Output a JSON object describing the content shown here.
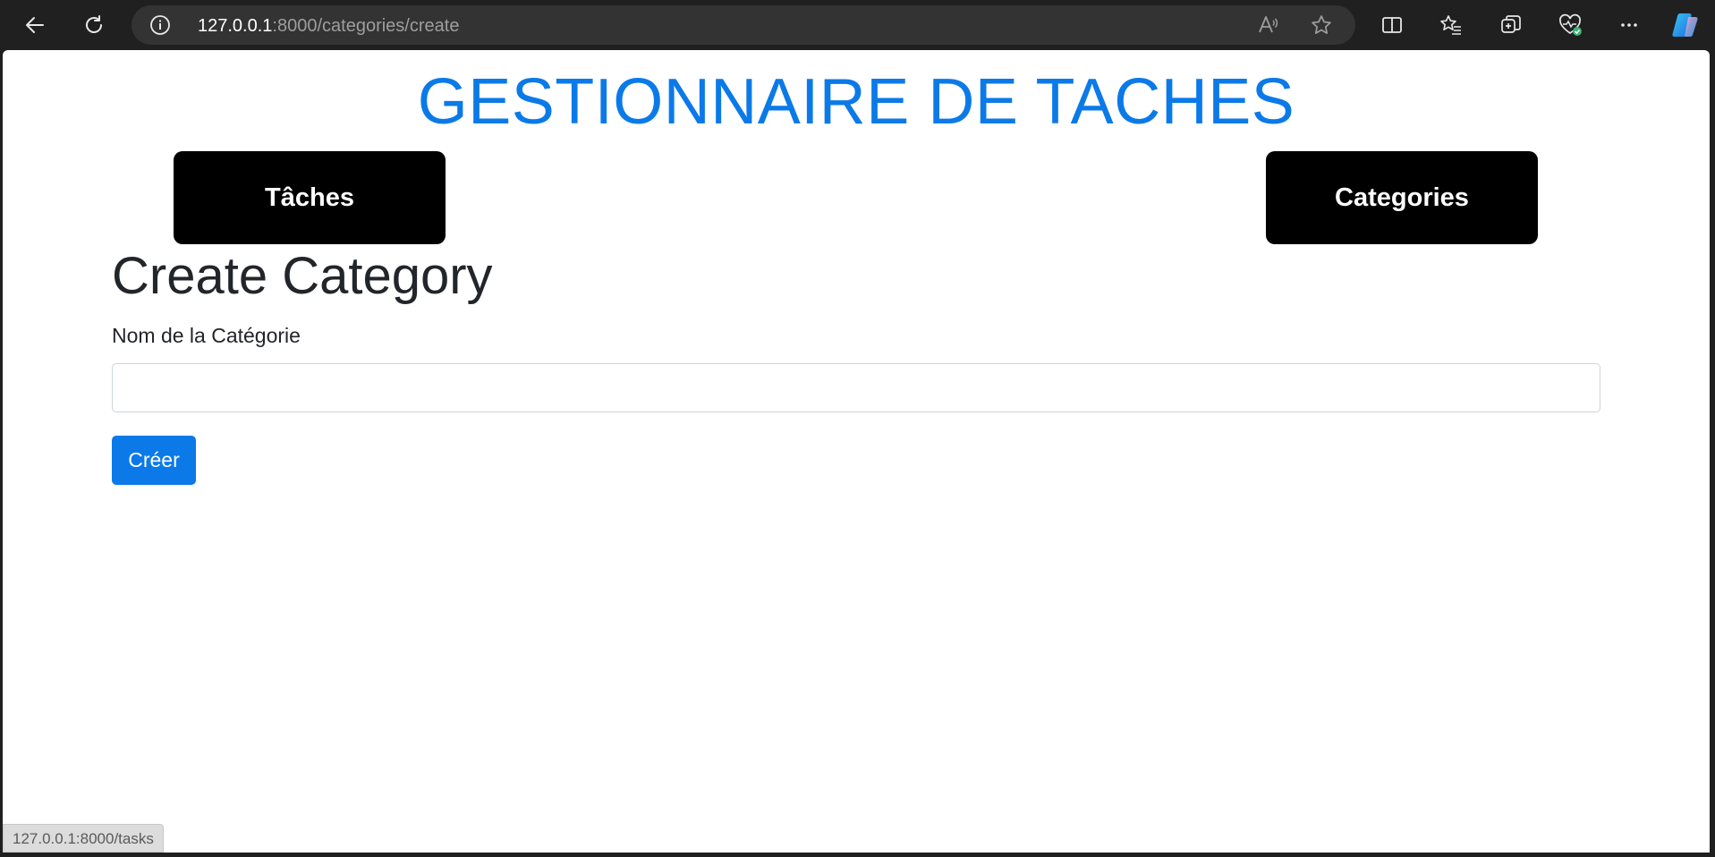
{
  "browser": {
    "url_host": "127.0.0.1",
    "url_rest": ":8000/categories/create",
    "icons": [
      "back-arrow-icon",
      "refresh-icon",
      "site-info-icon",
      "read-aloud-icon",
      "favorite-star-icon",
      "split-screen-icon",
      "favorites-icon",
      "collections-icon",
      "browser-essentials-icon",
      "more-options-icon",
      "copilot-icon"
    ]
  },
  "page": {
    "site_title": "GESTIONNAIRE DE TACHES",
    "nav": {
      "tasks_label": "Tâches",
      "categories_label": "Categories"
    },
    "heading": "Create Category",
    "form": {
      "name_label": "Nom de la Catégorie",
      "name_value": "",
      "submit_label": "Créer"
    }
  },
  "status_bar": {
    "link_preview": "127.0.0.1:8000/tasks"
  },
  "colors": {
    "accent": "#0b7ae8",
    "nav_button_bg": "#000000",
    "chrome_bg": "#202020"
  }
}
